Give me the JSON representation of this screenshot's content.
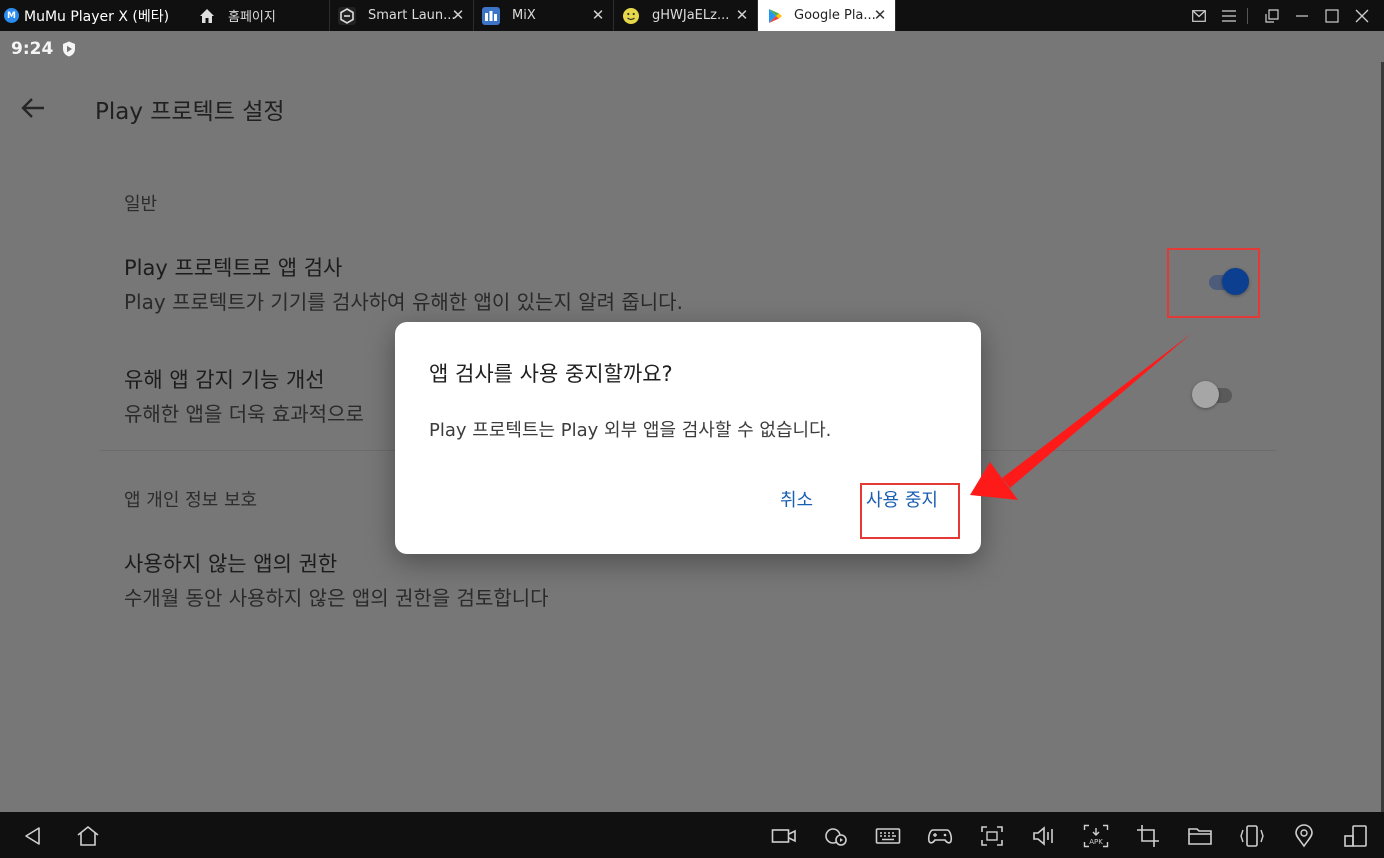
{
  "titlebar": {
    "app_name": "MuMu Player X (베타)",
    "tabs": [
      {
        "label": "홈페이지",
        "icon": "home-icon"
      },
      {
        "label": "Smart Laun...",
        "icon": "smart-launcher-icon"
      },
      {
        "label": "MiX",
        "icon": "mix-app-icon"
      },
      {
        "label": "gHWJaELz...",
        "icon": "smiley-icon"
      },
      {
        "label": "Google Pla...",
        "icon": "google-play-icon",
        "active": true
      }
    ],
    "window_controls": [
      "mail-icon",
      "menu-icon",
      "restore-icon",
      "minimize-icon",
      "maximize-icon",
      "close-icon"
    ]
  },
  "statusbar": {
    "time": "9:24"
  },
  "appbar": {
    "title": "Play 프로텍트 설정"
  },
  "sections": {
    "general": {
      "header": "일반",
      "scan_apps": {
        "title": "Play 프로텍트로 앱 검사",
        "summary": "Play 프로텍트가 기기를 검사하여 유해한 앱이 있는지 알려 줍니다.",
        "enabled": true
      },
      "improve_detection": {
        "title": "유해 앱 감지 기능 개선",
        "summary": "유해한 앱을 더욱 효과적으로",
        "enabled": false
      }
    },
    "privacy": {
      "header": "앱 개인 정보 보호",
      "unused_permissions": {
        "title": "사용하지 않는 앱의 권한",
        "summary": "수개월 동안 사용하지 않은 앱의 권한을 검토합니다"
      }
    }
  },
  "dialog": {
    "title": "앱 검사를 사용 중지할까요?",
    "message": "Play 프로텍트는 Play 외부 앱을 검사할 수 없습니다.",
    "cancel_label": "취소",
    "confirm_label": "사용 중지"
  },
  "colors": {
    "accent": "#1a5fb4",
    "switch_on": "#0c3f8f",
    "annotation": "#e53935"
  },
  "toolbar": {
    "icons": [
      "back-icon",
      "home-icon",
      "video-record-icon",
      "performance-icon",
      "keyboard-icon",
      "gamepad-icon",
      "screenshot-icon",
      "volume-icon",
      "apk-install-icon",
      "crop-icon",
      "folder-icon",
      "shake-icon",
      "location-icon",
      "multi-window-icon"
    ]
  }
}
